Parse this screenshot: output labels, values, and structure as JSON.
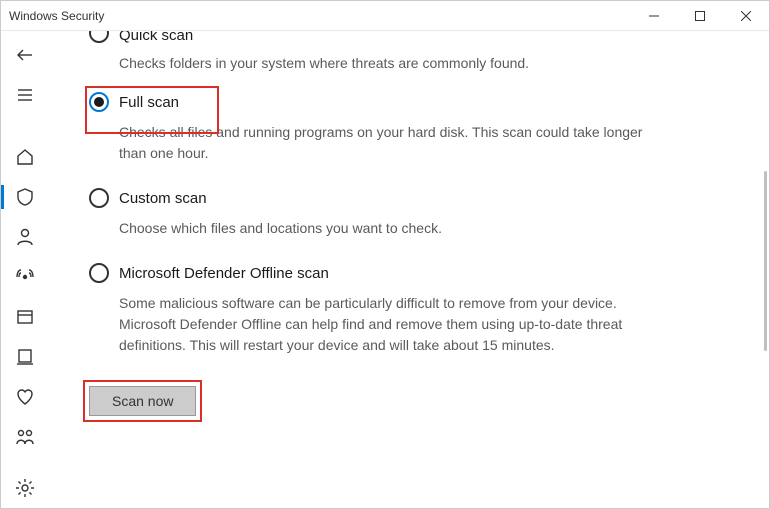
{
  "window": {
    "title": "Windows Security"
  },
  "options": {
    "quick": {
      "title": "Quick scan",
      "desc": "Checks folders in your system where threats are commonly found."
    },
    "full": {
      "title": "Full scan",
      "desc": "Checks all files and running programs on your hard disk. This scan could take longer than one hour."
    },
    "custom": {
      "title": "Custom scan",
      "desc": "Choose which files and locations you want to check."
    },
    "offline": {
      "title": "Microsoft Defender Offline scan",
      "desc": "Some malicious software can be particularly difficult to remove from your device. Microsoft Defender Offline can help find and remove them using up-to-date threat definitions. This will restart your device and will take about 15 minutes."
    }
  },
  "actions": {
    "scan_now": "Scan now"
  },
  "highlights": {
    "color": "#d93025"
  }
}
